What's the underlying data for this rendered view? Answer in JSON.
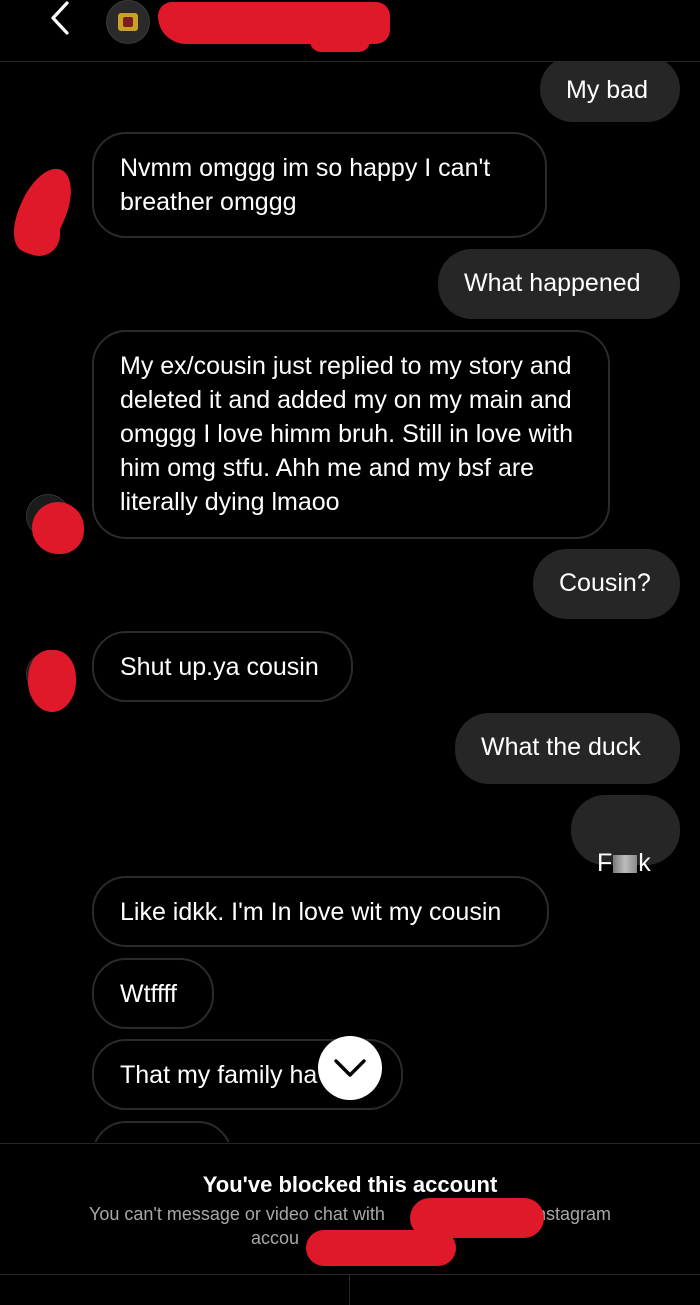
{
  "header": {
    "back_icon": "chevron-left-icon",
    "avatar_icon": "profile-avatar-icon"
  },
  "messages": [
    {
      "side": "out",
      "text": "My bad"
    },
    {
      "side": "in",
      "text": "Nvmm omggg im so happy I can't breather omggg"
    },
    {
      "side": "out",
      "text": "What happened"
    },
    {
      "side": "in",
      "text": "My ex/cousin just replied to my story and deleted it and added my on my main and omggg I love himm bruh. Still in love with him omg stfu. Ahh me and my bsf are literally dying lmaoo"
    },
    {
      "side": "out",
      "text": "Cousin?"
    },
    {
      "side": "in",
      "text": "Shut up.ya cousin"
    },
    {
      "side": "out",
      "text": "What the duck"
    },
    {
      "side": "out",
      "text_start": "F",
      "text_end": "k"
    },
    {
      "side": "in",
      "text": "Like idkk. I'm In love wit my cousin"
    },
    {
      "side": "in",
      "text": "Wtffff"
    },
    {
      "side": "in",
      "text": "That my family ha"
    }
  ],
  "scroll_button_icon": "chevron-down-icon",
  "footer": {
    "title": "You've blocked this account",
    "desc_part1": "You can't message or video chat with",
    "desc_part2": "Instagram",
    "desc_part3": "accou"
  },
  "colors": {
    "background": "#000000",
    "outgoing_bubble": "#262626",
    "redaction": "#e0192a",
    "secondary_text": "#a8a8a8"
  }
}
